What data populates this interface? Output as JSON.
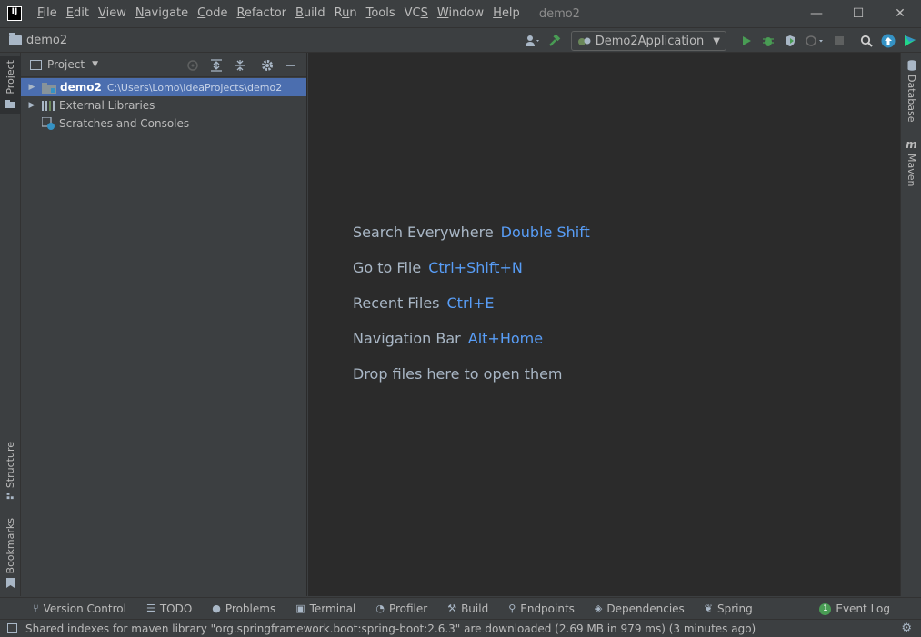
{
  "app": {
    "logo": "IJ",
    "title": "demo2"
  },
  "menu": [
    {
      "label": "File",
      "mnemonic": "F"
    },
    {
      "label": "Edit",
      "mnemonic": "E"
    },
    {
      "label": "View",
      "mnemonic": "V"
    },
    {
      "label": "Navigate",
      "mnemonic": "N"
    },
    {
      "label": "Code",
      "mnemonic": "C"
    },
    {
      "label": "Refactor",
      "mnemonic": "R"
    },
    {
      "label": "Build",
      "mnemonic": "B"
    },
    {
      "label": "Run",
      "mnemonic": "u"
    },
    {
      "label": "Tools",
      "mnemonic": "T"
    },
    {
      "label": "VCS",
      "mnemonic": "S"
    },
    {
      "label": "Window",
      "mnemonic": "W"
    },
    {
      "label": "Help",
      "mnemonic": "H"
    }
  ],
  "window_controls": {
    "minimize": "—",
    "maximize": "☐",
    "close": "✕"
  },
  "navbar": {
    "project": "demo2"
  },
  "toolbar": {
    "run_config": "Demo2Application"
  },
  "left_tabs": {
    "project": "Project",
    "structure": "Structure",
    "bookmarks": "Bookmarks"
  },
  "right_tabs": {
    "database": "Database",
    "maven": "Maven",
    "maven_glyph": "m"
  },
  "project_panel": {
    "title": "Project",
    "tree": [
      {
        "name": "demo2",
        "path": "C:\\Users\\Lomo\\IdeaProjects\\demo2",
        "selected": true
      },
      {
        "name": "External Libraries"
      },
      {
        "name": "Scratches and Consoles"
      }
    ]
  },
  "editor_hints": [
    {
      "text": "Search Everywhere",
      "key": "Double Shift"
    },
    {
      "text": "Go to File",
      "key": "Ctrl+Shift+N"
    },
    {
      "text": "Recent Files",
      "key": "Ctrl+E"
    },
    {
      "text": "Navigation Bar",
      "key": "Alt+Home"
    },
    {
      "text": "Drop files here to open them",
      "key": ""
    }
  ],
  "bottom_tools": [
    {
      "label": "Version Control",
      "icon": "branch-icon"
    },
    {
      "label": "TODO",
      "icon": "list-icon"
    },
    {
      "label": "Problems",
      "icon": "info-icon"
    },
    {
      "label": "Terminal",
      "icon": "terminal-icon"
    },
    {
      "label": "Profiler",
      "icon": "profiler-icon"
    },
    {
      "label": "Build",
      "icon": "hammer-icon"
    },
    {
      "label": "Endpoints",
      "icon": "endpoints-icon"
    },
    {
      "label": "Dependencies",
      "icon": "layers-icon"
    },
    {
      "label": "Spring",
      "icon": "leaf-icon"
    }
  ],
  "event_log": {
    "label": "Event Log",
    "count": "1"
  },
  "status": {
    "message": "Shared indexes for maven library \"org.springframework.boot:spring-boot:2.6.3\" are downloaded (2.69 MB in 979 ms) (3 minutes ago)"
  },
  "colors": {
    "accent": "#589df6",
    "selection": "#4b6eaf",
    "run": "#499c54"
  }
}
